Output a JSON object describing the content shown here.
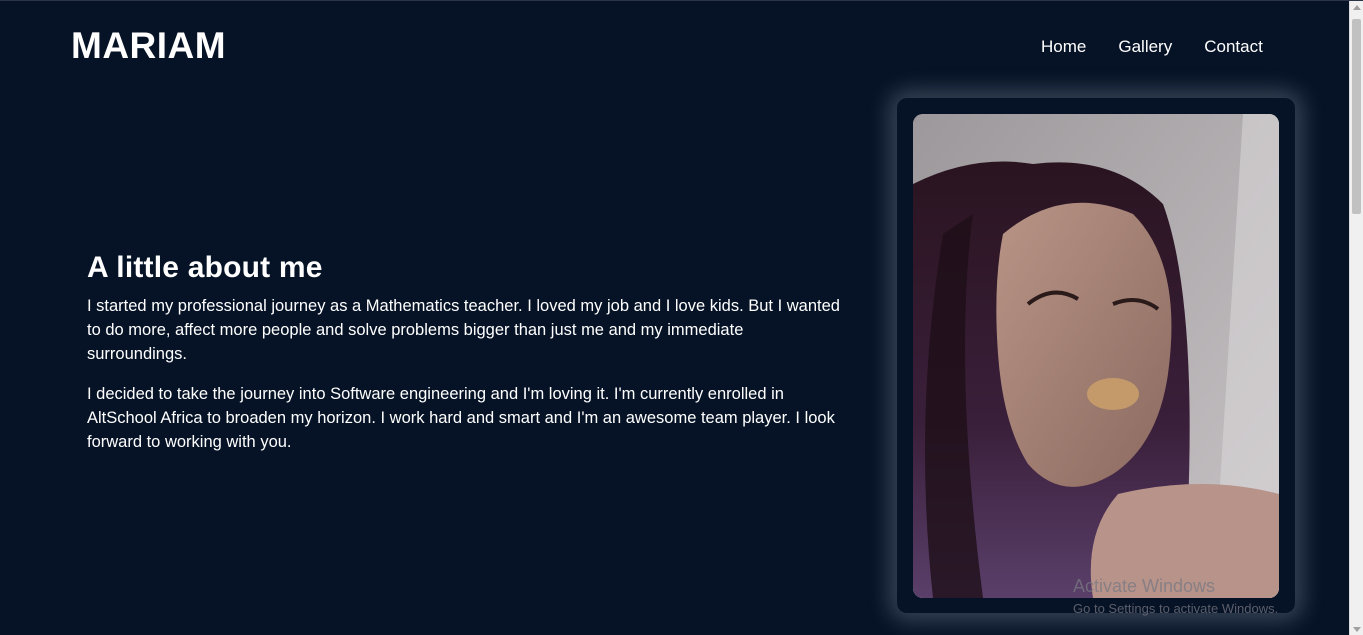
{
  "header": {
    "logo": "MARIAM",
    "nav": [
      {
        "label": "Home"
      },
      {
        "label": "Gallery"
      },
      {
        "label": "Contact"
      }
    ]
  },
  "about": {
    "title": "A little about me",
    "paragraphs": [
      "I started my professional journey as a Mathematics teacher. I loved my job and I love kids. But I wanted to do more, affect more people and solve problems bigger than just me and my immediate surroundings.",
      "I decided to take the journey into Software engineering and I'm loving it. I'm currently enrolled in AltSchool Africa to broaden my horizon. I work hard and smart and I'm an awesome team player. I look forward to working with you."
    ]
  },
  "watermark": {
    "title": "Activate Windows",
    "subtitle": "Go to Settings to activate Windows."
  },
  "colors": {
    "background": "#061326",
    "text": "#ffffff"
  }
}
